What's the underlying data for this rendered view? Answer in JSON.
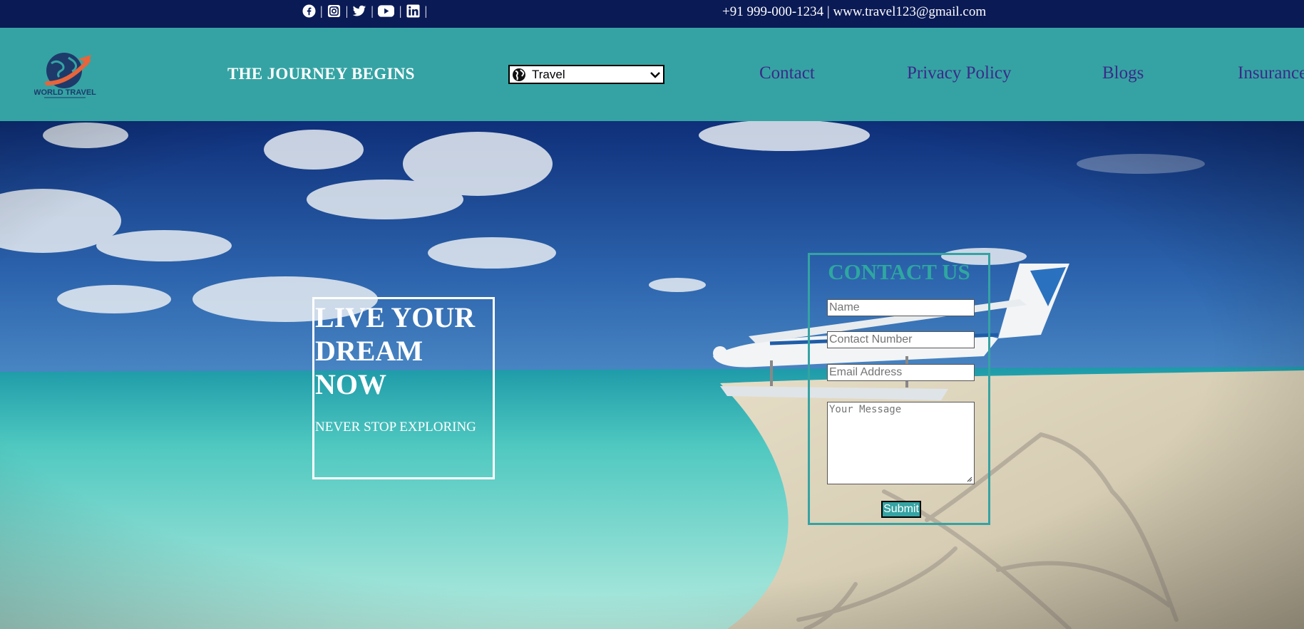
{
  "topbar": {
    "social_icons": [
      "facebook-icon",
      "instagram-icon",
      "twitter-icon",
      "youtube-icon",
      "linkedin-icon"
    ],
    "separator": "|",
    "phone": "+91 999-000-1234",
    "contact_sep": "|",
    "email": "www.travel123@gmail.com"
  },
  "header": {
    "logo_text": "WORLD TRAVEL",
    "tagline": "THE JOURNEY BEGINS",
    "select": {
      "icon": "globe-icon",
      "value": "Travel"
    },
    "nav": [
      "Contact",
      "Privacy Policy",
      "Blogs",
      "Insurance"
    ]
  },
  "hero": {
    "title_lines": [
      "LIVE YOUR",
      "DREAM",
      "NOW"
    ],
    "subtitle": "NEVER STOP EXPLORING"
  },
  "contact_form": {
    "title": "CONTACT US",
    "name_placeholder": "Name",
    "phone_placeholder": "Contact Number",
    "email_placeholder": "Email Address",
    "message_placeholder": "Your Message",
    "submit_label": "Submit"
  },
  "colors": {
    "topbar_bg": "#0a1a55",
    "header_bg": "#35a3a3",
    "nav_text": "#3b2a8a",
    "accent": "#35a3a3"
  }
}
